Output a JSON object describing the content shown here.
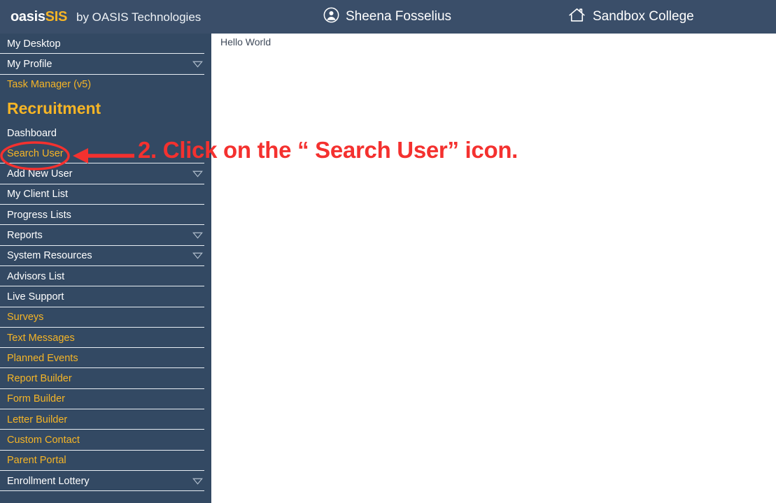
{
  "topbar": {
    "brand_primary": "oasis",
    "brand_accent": "SIS",
    "brand_tagline": "by OASIS Technologies",
    "user_name": "Sheena Fosselius",
    "user_icon": "user-circle-icon",
    "school_name": "Sandbox College",
    "school_icon": "home-icon",
    "background": "#3a4e69"
  },
  "sidebar": {
    "background": "#334963",
    "accent_color": "#f6b526",
    "text_color": "#ffffff",
    "section_heading": "Recruitment",
    "items": [
      {
        "label": "My Desktop",
        "style": "plain",
        "chevron": false
      },
      {
        "label": "My Profile",
        "style": "plain",
        "chevron": true
      },
      {
        "label": "Task Manager (v5)",
        "style": "amber",
        "chevron": false
      },
      {
        "label": "Dashboard",
        "style": "plain",
        "chevron": false
      },
      {
        "label": "Search User",
        "style": "amber",
        "chevron": false
      },
      {
        "label": "Add New User",
        "style": "plain",
        "chevron": true
      },
      {
        "label": "My Client List",
        "style": "plain",
        "chevron": false
      },
      {
        "label": "Progress Lists",
        "style": "plain",
        "chevron": false
      },
      {
        "label": "Reports",
        "style": "plain",
        "chevron": true
      },
      {
        "label": "System Resources",
        "style": "plain",
        "chevron": true
      },
      {
        "label": "Advisors List",
        "style": "plain",
        "chevron": false
      },
      {
        "label": "Live Support",
        "style": "plain",
        "chevron": false
      },
      {
        "label": "Surveys",
        "style": "amber",
        "chevron": false
      },
      {
        "label": "Text Messages",
        "style": "amber",
        "chevron": false
      },
      {
        "label": "Planned Events",
        "style": "amber",
        "chevron": false
      },
      {
        "label": "Report Builder",
        "style": "amber",
        "chevron": false
      },
      {
        "label": "Form Builder",
        "style": "amber",
        "chevron": false
      },
      {
        "label": "Letter Builder",
        "style": "amber",
        "chevron": false
      },
      {
        "label": "Custom Contact",
        "style": "amber",
        "chevron": false
      },
      {
        "label": "Parent Portal",
        "style": "amber",
        "chevron": false
      },
      {
        "label": "Enrollment Lottery",
        "style": "plain",
        "chevron": true
      }
    ]
  },
  "content": {
    "body_text": "Hello World"
  },
  "annotation": {
    "instruction_text": "2. Click on the “ Search User” icon.",
    "color": "#f4312f",
    "highlight_target": "Search User"
  }
}
